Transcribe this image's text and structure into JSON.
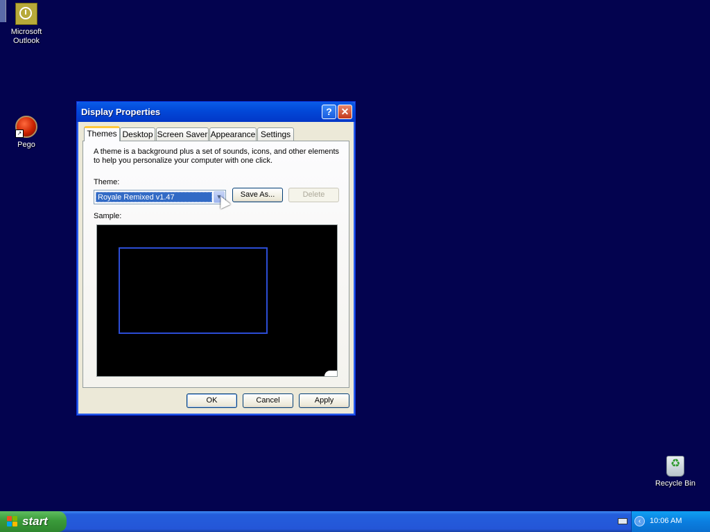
{
  "desktop": {
    "icons": [
      {
        "label_line1": "Microsoft",
        "label_line2": "Outlook",
        "icon": "outlook-icon"
      },
      {
        "label_line1": "Pego",
        "label_line2": "",
        "icon": "pego-icon"
      },
      {
        "label_line1": "Recycle Bin",
        "label_line2": "",
        "icon": "recycle-bin-icon"
      }
    ]
  },
  "dialog": {
    "title": "Display Properties",
    "help_glyph": "?",
    "close_glyph": "✕",
    "tabs": [
      {
        "label": "Themes",
        "active": true
      },
      {
        "label": "Desktop",
        "active": false
      },
      {
        "label": "Screen Saver",
        "active": false
      },
      {
        "label": "Appearance",
        "active": false
      },
      {
        "label": "Settings",
        "active": false
      }
    ],
    "description": "A theme is a background plus a set of sounds, icons, and other elements to help you personalize your computer with one click.",
    "theme_label": "Theme:",
    "theme_value": "Royale Remixed v1.47",
    "save_as_label": "Save As...",
    "delete_label": "Delete",
    "sample_label": "Sample:",
    "ok_label": "OK",
    "cancel_label": "Cancel",
    "apply_label": "Apply"
  },
  "taskbar": {
    "start_label": "start",
    "clock": "10:06 AM"
  },
  "colors": {
    "desktop_background": "#03034f",
    "title_bar": "#0248d8",
    "selection": "#316ac5",
    "taskbar": "#245edb",
    "start_button": "#3a9a3a"
  }
}
